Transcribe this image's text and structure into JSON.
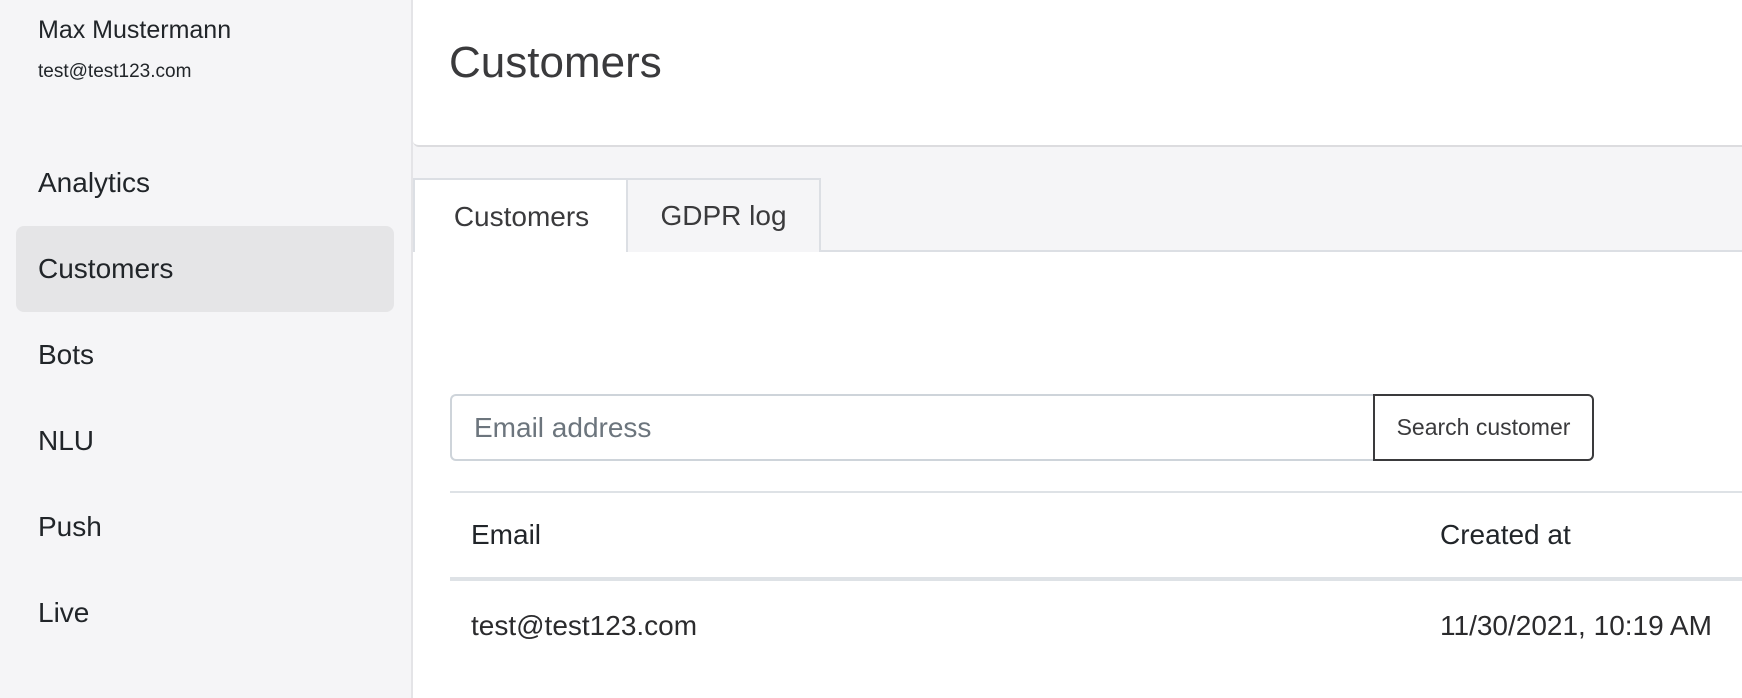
{
  "user": {
    "name": "Max Mustermann",
    "email": "test@test123.com"
  },
  "sidebar": {
    "items": [
      {
        "label": "Analytics",
        "active": false
      },
      {
        "label": "Customers",
        "active": true
      },
      {
        "label": "Bots",
        "active": false
      },
      {
        "label": "NLU",
        "active": false
      },
      {
        "label": "Push",
        "active": false
      },
      {
        "label": "Live",
        "active": false
      }
    ]
  },
  "header": {
    "title": "Customers"
  },
  "tabs": [
    {
      "label": "Customers",
      "active": true
    },
    {
      "label": "GDPR log",
      "active": false
    }
  ],
  "search": {
    "placeholder": "Email address",
    "value": "",
    "button_label": "Search customer"
  },
  "table": {
    "columns": [
      "Email",
      "Created at"
    ],
    "rows": [
      [
        "test@test123.com",
        "11/30/2021, 10:19 AM"
      ]
    ]
  },
  "colors": {
    "sidebar_bg": "#f5f5f7",
    "active_nav_bg": "#e5e5e7",
    "content_bg": "#ffffff",
    "text": "#212529"
  }
}
